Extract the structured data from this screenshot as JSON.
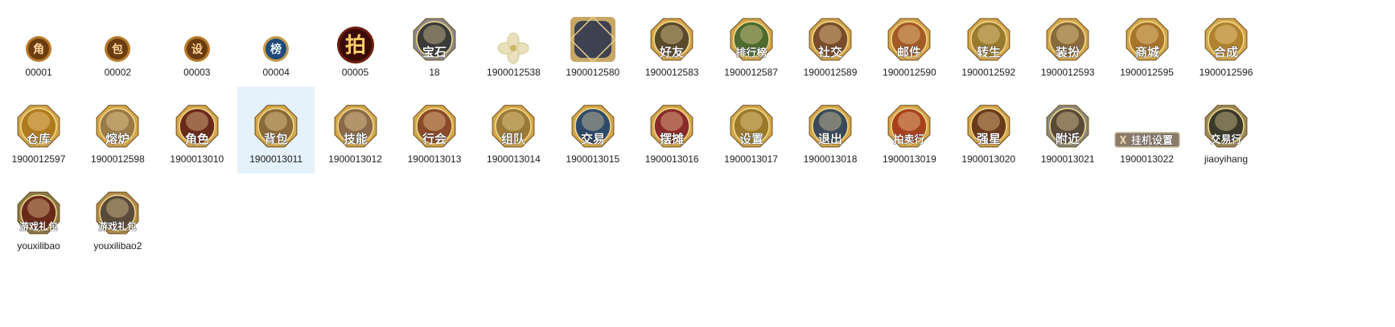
{
  "window": {
    "title": ""
  },
  "files": [
    {
      "name": "00001",
      "kind": "small",
      "glyph": "角",
      "bg": "#6b3c10",
      "ring": "#b77a2a",
      "fill": "#ffd8a0"
    },
    {
      "name": "00002",
      "kind": "small",
      "glyph": "包",
      "bg": "#6b3c10",
      "ring": "#b77a2a",
      "fill": "#ffd8a0"
    },
    {
      "name": "00003",
      "kind": "small",
      "glyph": "设",
      "bg": "#6b3c10",
      "ring": "#b77a2a",
      "fill": "#ffd8a0"
    },
    {
      "name": "00004",
      "kind": "small",
      "glyph": "榜",
      "bg": "#1f4a78",
      "ring": "#c49a4e",
      "fill": "#e8f2ff"
    },
    {
      "name": "00005",
      "kind": "medium",
      "glyph": "拍",
      "bg": "#3a0c05",
      "ring": "#6b1e0c",
      "fill": "#ffd06a"
    },
    {
      "name": "18",
      "kind": "badge",
      "glyph": "宝石",
      "bg": "#3b3b3b",
      "ring": "#8a8a8a",
      "fill": "#ffffff"
    },
    {
      "name": "1900012538",
      "kind": "flower",
      "glyph": "",
      "bg": "#e9e1bd",
      "ring": "#d2c88e",
      "fill": "#ffffff"
    },
    {
      "name": "1900012580",
      "kind": "frame",
      "glyph": "",
      "bg": "#3d4150",
      "ring": "#c6a766",
      "fill": "#ffffff"
    },
    {
      "name": "1900012583",
      "kind": "badge",
      "glyph": "好友",
      "bg": "#5a4a2c",
      "ring": "#d3a64a",
      "fill": "#ffffff"
    },
    {
      "name": "1900012587",
      "kind": "badge",
      "glyph": "排行榜",
      "bg": "#4d6a2f",
      "ring": "#d3a64a",
      "fill": "#ffffff"
    },
    {
      "name": "1900012589",
      "kind": "badge",
      "glyph": "社交",
      "bg": "#7a4d2a",
      "ring": "#d3a64a",
      "fill": "#ffffff"
    },
    {
      "name": "1900012590",
      "kind": "badge",
      "glyph": "邮件",
      "bg": "#a35a26",
      "ring": "#d3a64a",
      "fill": "#ffffff"
    },
    {
      "name": "1900012592",
      "kind": "badge",
      "glyph": "转生",
      "bg": "#9a7a2e",
      "ring": "#d3a64a",
      "fill": "#ffffff"
    },
    {
      "name": "1900012593",
      "kind": "badge",
      "glyph": "装扮",
      "bg": "#8a6a3a",
      "ring": "#d3a64a",
      "fill": "#ffffff"
    },
    {
      "name": "1900012595",
      "kind": "badge",
      "glyph": "商城",
      "bg": "#a8742a",
      "ring": "#d3a64a",
      "fill": "#ffffff"
    },
    {
      "name": "1900012596",
      "kind": "badge",
      "glyph": "合成",
      "bg": "#b0822e",
      "ring": "#d3a64a",
      "fill": "#ffffff"
    },
    {
      "name": "1900012597",
      "kind": "badge",
      "glyph": "仓库",
      "bg": "#b07a1e",
      "ring": "#d3a64a",
      "fill": "#ffffff"
    },
    {
      "name": "1900012598",
      "kind": "badge",
      "glyph": "熔炉",
      "bg": "#9a7a46",
      "ring": "#d3a64a",
      "fill": "#ffffff"
    },
    {
      "name": "1900013010",
      "kind": "badge",
      "glyph": "角色",
      "bg": "#6a2a1a",
      "ring": "#d3a64a",
      "fill": "#ffffff"
    },
    {
      "name": "1900013011",
      "kind": "badge",
      "glyph": "背包",
      "bg": "#8a6a3a",
      "ring": "#d3a64a",
      "fill": "#ffffff",
      "selected": true
    },
    {
      "name": "1900013012",
      "kind": "badge",
      "glyph": "技能",
      "bg": "#8a6a4a",
      "ring": "#d3a64a",
      "fill": "#ffffff"
    },
    {
      "name": "1900013013",
      "kind": "badge",
      "glyph": "行会",
      "bg": "#8a4a2a",
      "ring": "#d3a64a",
      "fill": "#ffffff"
    },
    {
      "name": "1900013014",
      "kind": "badge",
      "glyph": "组队",
      "bg": "#9a7a36",
      "ring": "#d3a64a",
      "fill": "#ffffff"
    },
    {
      "name": "1900013015",
      "kind": "badge",
      "glyph": "交易",
      "bg": "#2e4a6a",
      "ring": "#d3a64a",
      "fill": "#ffffff"
    },
    {
      "name": "1900013016",
      "kind": "badge",
      "glyph": "摆摊",
      "bg": "#8a2a2a",
      "ring": "#d3a64a",
      "fill": "#ffffff"
    },
    {
      "name": "1900013017",
      "kind": "badge",
      "glyph": "设置",
      "bg": "#9a7a2a",
      "ring": "#d3a64a",
      "fill": "#ffffff"
    },
    {
      "name": "1900013018",
      "kind": "badge",
      "glyph": "退出",
      "bg": "#3a4a5a",
      "ring": "#d3a64a",
      "fill": "#ffffff"
    },
    {
      "name": "1900013019",
      "kind": "badge",
      "glyph": "拍卖行",
      "bg": "#a8421e",
      "ring": "#d3a64a",
      "fill": "#ffffff"
    },
    {
      "name": "1900013020",
      "kind": "badge",
      "glyph": "强星",
      "bg": "#6a3a1a",
      "ring": "#d3a64a",
      "fill": "#ffffff"
    },
    {
      "name": "1900013021",
      "kind": "badge",
      "glyph": "附近",
      "bg": "#5a4a3a",
      "ring": "#8a8a7a",
      "fill": "#ffffff"
    },
    {
      "name": "1900013022",
      "kind": "bar",
      "glyph": "挂机设置",
      "bg": "#8a7a6a",
      "ring": "#c8b89a",
      "fill": "#ffffff"
    },
    {
      "name": "jiaoyihang",
      "kind": "badge",
      "glyph": "交易行",
      "bg": "#3a3a2a",
      "ring": "#9a8a5a",
      "fill": "#ffffff"
    },
    {
      "name": "youxilibao",
      "kind": "badge",
      "glyph": "游戏礼包",
      "bg": "#6a2a1a",
      "ring": "#8a7a4a",
      "fill": "#ffffff"
    },
    {
      "name": "youxilibao2",
      "kind": "badge",
      "glyph": "游戏礼包",
      "bg": "#5a4a3a",
      "ring": "#b08a4a",
      "fill": "#ffffff"
    }
  ]
}
